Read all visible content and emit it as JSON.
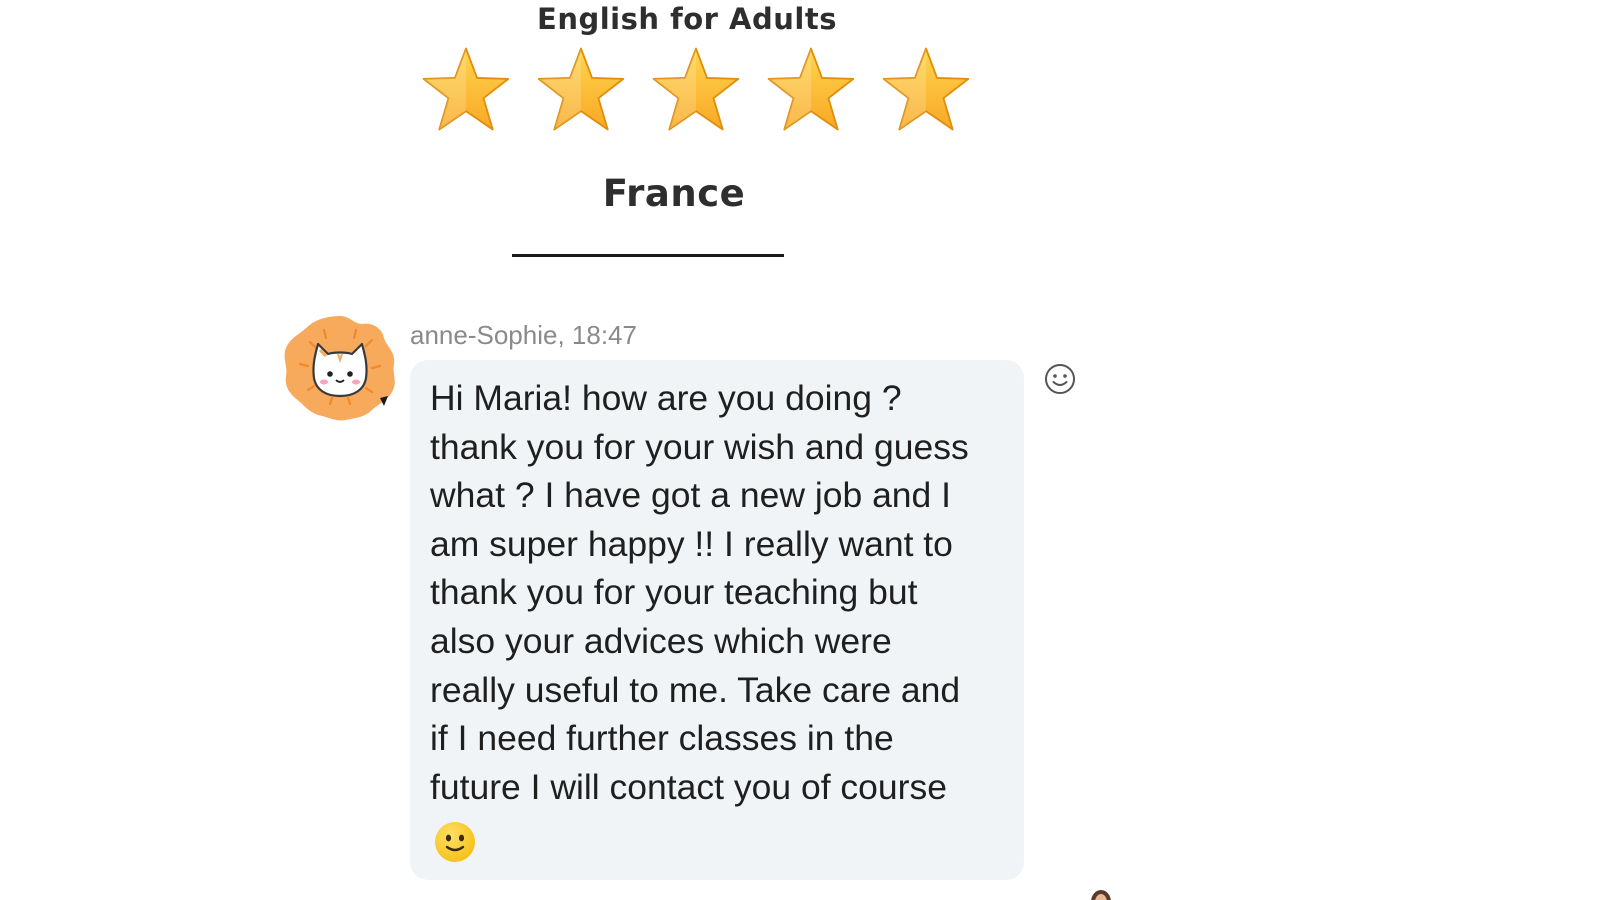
{
  "review": {
    "course_title": "English for Adults",
    "rating": {
      "value": 5,
      "max": 5
    },
    "country": "France"
  },
  "chat": {
    "sender": "anne-Sophie",
    "time": "18:47",
    "sender_line": "anne-Sophie, 18:47",
    "message": "Hi Maria! how are you doing ?\nthank you for your wish and guess\nwhat ? I have got a new job and I\nam super happy !! I really want to\nthank you for your teaching but\nalso your advices which were\nreally useful to me.  Take care and\nif I need further classes in the\nfuture I will contact you of course",
    "message_emoji": "slightly-smiling-face-emoji",
    "avatar_icon": "cat-avatar-icon",
    "reaction_icon": "smiley-outline-icon"
  },
  "colors": {
    "star": "#f9a825",
    "bubble": "#f1f4f7",
    "avatar_orange": "#f7a95c",
    "meta_text": "#8a8a8a",
    "heading_text": "#2e2e2e"
  }
}
